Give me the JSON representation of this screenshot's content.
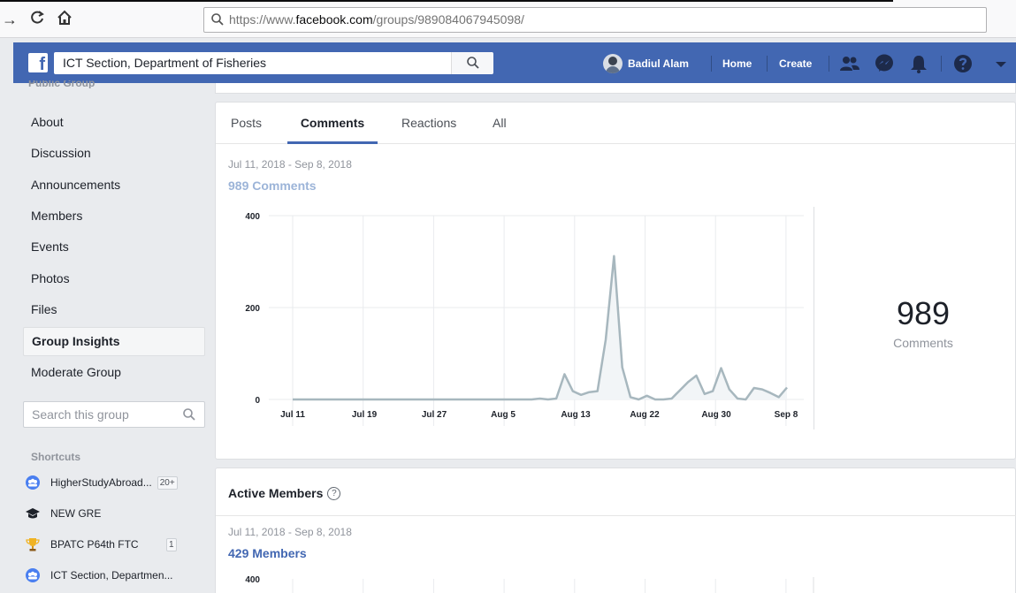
{
  "browser": {
    "url_prefix": "https://www.",
    "url_domain": "facebook.com",
    "url_path": "/groups/989084067945098/"
  },
  "fb": {
    "search_value": "ICT Section, Department of Fisheries",
    "user_name": "Badiul Alam",
    "home_label": "Home",
    "create_label": "Create",
    "brand_color": "#4267b2"
  },
  "sidebar": {
    "public_group": "Public Group",
    "items": [
      {
        "label": "About"
      },
      {
        "label": "Discussion"
      },
      {
        "label": "Announcements"
      },
      {
        "label": "Members"
      },
      {
        "label": "Events"
      },
      {
        "label": "Photos"
      },
      {
        "label": "Files"
      },
      {
        "label": "Group Insights",
        "active": true
      },
      {
        "label": "Moderate Group"
      }
    ],
    "search_placeholder": "Search this group",
    "shortcuts_heading": "Shortcuts",
    "shortcuts": [
      {
        "label": "HigherStudyAbroad...",
        "badge": "20+",
        "icon": "group-icon"
      },
      {
        "label": "NEW GRE",
        "badge": "",
        "icon": "graduation-cap-icon"
      },
      {
        "label": "BPATC P64th FTC",
        "badge": "1",
        "icon": "trophy-icon"
      },
      {
        "label": "ICT Section, Departmen...",
        "badge": "",
        "icon": "group-icon"
      }
    ]
  },
  "comments_card": {
    "tabs": [
      "Posts",
      "Comments",
      "Reactions",
      "All"
    ],
    "active_tab": "Comments",
    "date_range": "Jul 11, 2018 - Sep 8, 2018",
    "count_label": "989 Comments",
    "summary_value": "989",
    "summary_label": "Comments"
  },
  "members_card": {
    "title": "Active Members",
    "date_range": "Jul 11, 2018 - Sep 8, 2018",
    "count_label": "429 Members"
  },
  "chart_data": [
    {
      "type": "area",
      "title": "",
      "xlabel": "",
      "ylabel": "",
      "ylim": [
        0,
        400
      ],
      "yticks": [
        "0",
        "200",
        "400"
      ],
      "xticks": [
        "Jul 11",
        "Jul 19",
        "Jul 27",
        "Aug 5",
        "Aug 13",
        "Aug 22",
        "Aug 30",
        "Sep 8"
      ],
      "grid": true,
      "color": "#a7b7be",
      "series": [
        {
          "values": [
            0,
            0,
            0,
            0,
            0,
            0,
            0,
            0,
            0,
            0,
            0,
            0,
            0,
            0,
            0,
            0,
            0,
            0,
            0,
            0,
            0,
            0,
            0,
            0,
            0,
            0,
            0,
            0,
            0,
            0,
            2,
            0,
            2,
            55,
            18,
            10,
            16,
            18,
            130,
            312,
            70,
            5,
            0,
            8,
            0,
            0,
            2,
            20,
            38,
            52,
            12,
            18,
            68,
            22,
            2,
            0,
            25,
            22,
            14,
            5,
            26
          ]
        }
      ]
    },
    {
      "type": "line",
      "title": "",
      "xlabel": "",
      "ylabel": "",
      "yticks": [
        "400"
      ],
      "grid": true,
      "series": []
    }
  ]
}
